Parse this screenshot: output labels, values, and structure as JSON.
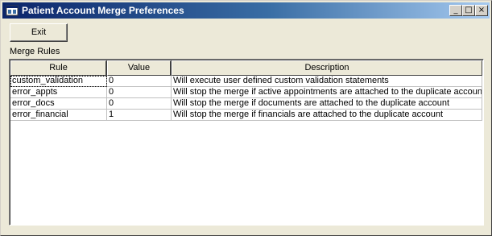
{
  "window": {
    "title": "Patient Account Merge Preferences",
    "controls": {
      "minimize": "_",
      "maximize": "□",
      "close": "×"
    }
  },
  "toolbar": {
    "exit_label": "Exit"
  },
  "section": {
    "label": "Merge Rules"
  },
  "table": {
    "headers": {
      "rule": "Rule",
      "value": "Value",
      "description": "Description"
    },
    "rows": [
      {
        "rule": "custom_validation",
        "value": "0",
        "description": "Will execute user defined custom validation statements"
      },
      {
        "rule": "error_appts",
        "value": "0",
        "description": "Will stop the merge if active appointments are attached to the duplicate account"
      },
      {
        "rule": "error_docs",
        "value": "0",
        "description": "Will stop the merge if documents are attached to the duplicate account"
      },
      {
        "rule": "error_financial",
        "value": "1",
        "description": "Will stop the merge if financials are attached to the duplicate account"
      }
    ]
  },
  "colors": {
    "title_start": "#0a246a",
    "title_end": "#a6caf0",
    "face": "#ece9d8"
  }
}
